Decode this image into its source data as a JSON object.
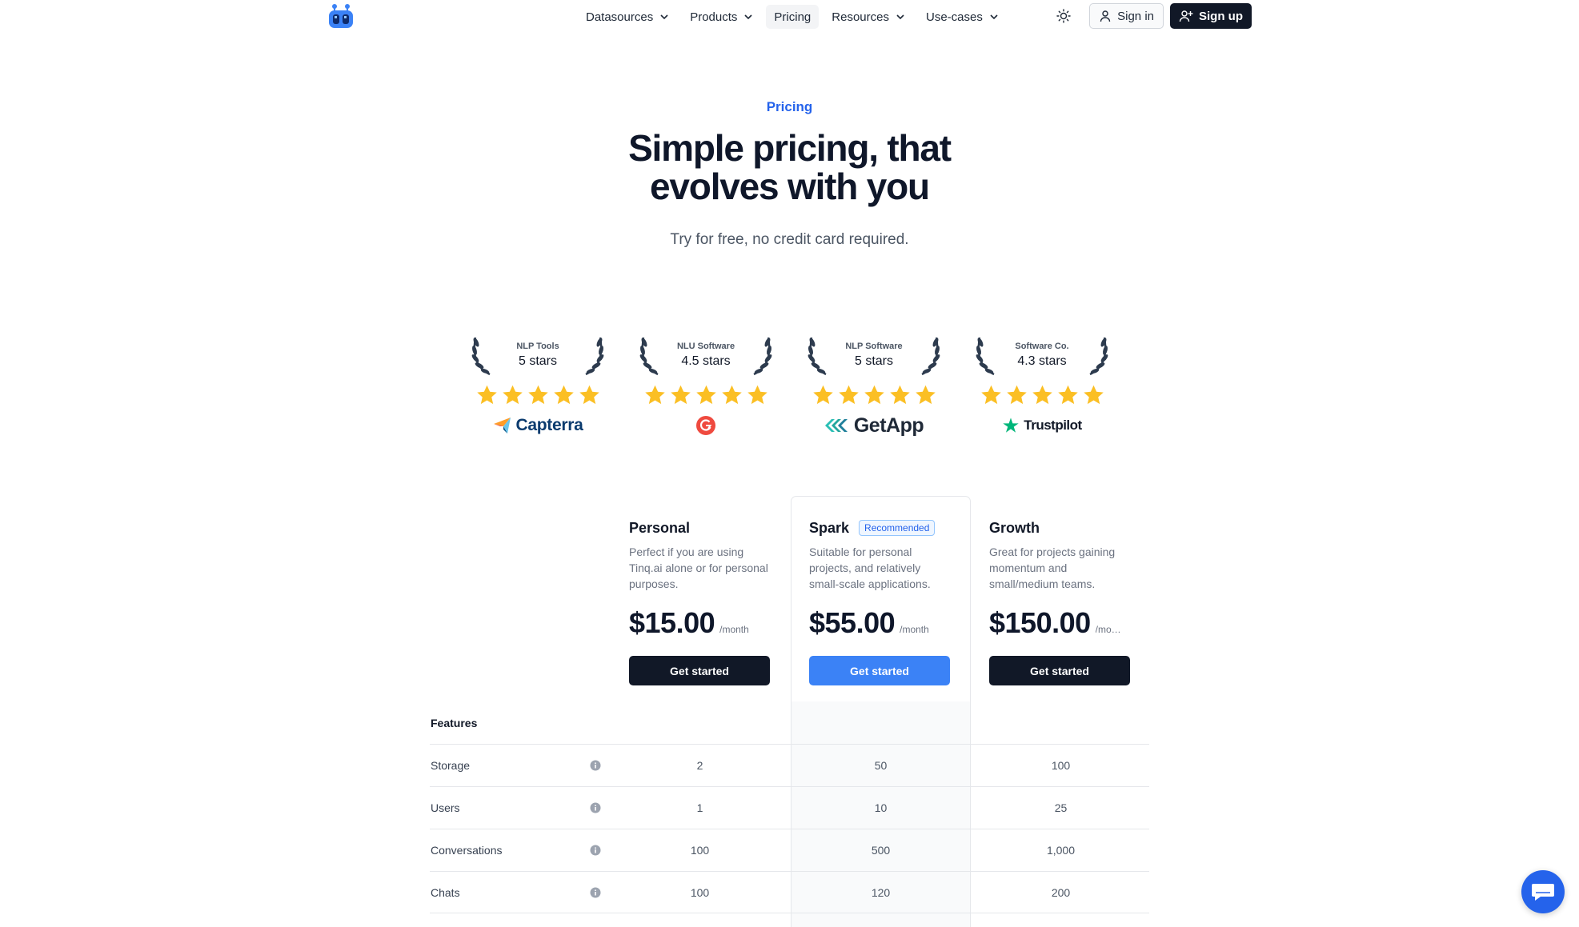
{
  "nav": {
    "items": [
      {
        "label": "Datasources",
        "has_dropdown": true,
        "active": false
      },
      {
        "label": "Products",
        "has_dropdown": true,
        "active": false
      },
      {
        "label": "Pricing",
        "has_dropdown": false,
        "active": true
      },
      {
        "label": "Resources",
        "has_dropdown": true,
        "active": false
      },
      {
        "label": "Use-cases",
        "has_dropdown": true,
        "active": false
      }
    ],
    "signin_label": "Sign in",
    "signup_label": "Sign up"
  },
  "hero": {
    "eyebrow": "Pricing",
    "headline_line1": "Simple pricing, that",
    "headline_line2": "evolves with you",
    "subline": "Try for free, no credit card required."
  },
  "awards": [
    {
      "category": "NLP Tools",
      "score": "5 stars",
      "brand": "Capterra",
      "rating": 5
    },
    {
      "category": "NLU Software",
      "score": "4.5 stars",
      "brand": "G2",
      "rating": 5
    },
    {
      "category": "NLP Software",
      "score": "5 stars",
      "brand": "GetApp",
      "rating": 5
    },
    {
      "category": "Software Co.",
      "score": "4.3 stars",
      "brand": "Trustpilot",
      "rating": 5
    }
  ],
  "plans": [
    {
      "name": "Personal",
      "badge": "",
      "description": "Perfect if you are using Tinq.ai alone or for personal purposes.",
      "price": "$15.00",
      "period": "/month",
      "cta": "Get started"
    },
    {
      "name": "Spark",
      "badge": "Recommended",
      "description": "Suitable for personal projects, and relatively small-scale applications.",
      "price": "$55.00",
      "period": "/month",
      "cta": "Get started"
    },
    {
      "name": "Growth",
      "badge": "",
      "description": "Great for projects gaining momentum and small/medium teams.",
      "price": "$150.00",
      "period": "/month",
      "cta": "Get started"
    }
  ],
  "features": {
    "heading": "Features",
    "rows": [
      {
        "label": "Storage",
        "values": [
          "2",
          "50",
          "100"
        ]
      },
      {
        "label": "Users",
        "values": [
          "1",
          "10",
          "25"
        ]
      },
      {
        "label": "Conversations",
        "values": [
          "100",
          "500",
          "1,000"
        ]
      },
      {
        "label": "Chats",
        "values": [
          "100",
          "120",
          "200"
        ]
      }
    ]
  },
  "colors": {
    "accent": "#3b82f6",
    "dark": "#111827",
    "star": "#fbbf24",
    "muted": "#6b7280"
  },
  "icons": {
    "logo": "robot-logo-icon",
    "theme": "sun-icon",
    "signin": "user-icon",
    "signup": "user-plus-icon",
    "info": "info-icon",
    "chat": "chat-bubble-icon"
  }
}
